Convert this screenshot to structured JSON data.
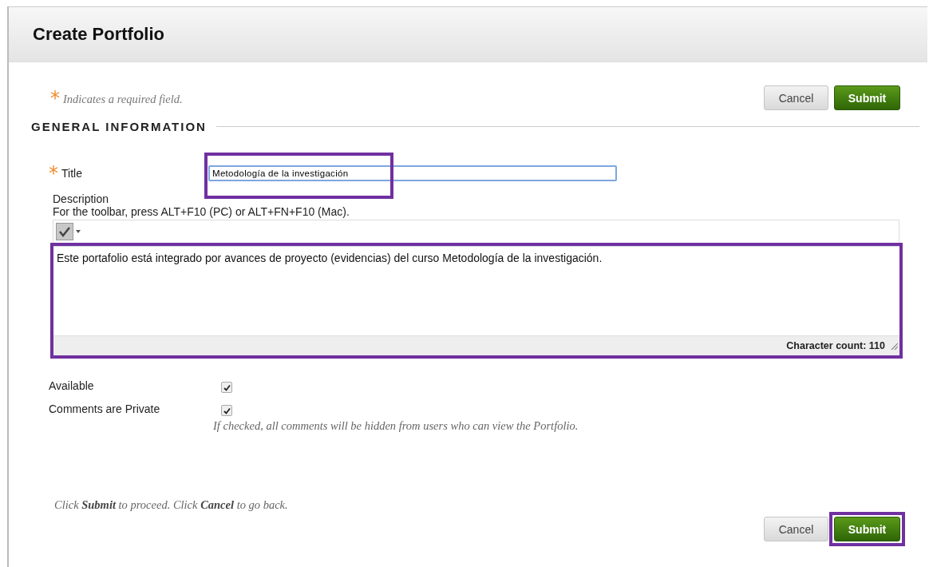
{
  "page": {
    "title": "Create Portfolio"
  },
  "required_note": "Indicates a required field.",
  "required_mark": "*",
  "top_buttons": [
    {
      "kind": "cancel",
      "label": "Cancel"
    },
    {
      "kind": "submit",
      "label": "Submit"
    }
  ],
  "section": {
    "heading": "GENERAL INFORMATION"
  },
  "title_field": {
    "label": "Title",
    "required": true,
    "value": "Metodología de la investigación",
    "highlighted": true
  },
  "description": {
    "label": "Description",
    "hint": "For the toolbar, press ALT+F10 (PC) or ALT+FN+F10 (Mac).",
    "text": "Este portafolio está integrado por avances de proyecto (evidencias) del curso Metodología de la investigación.",
    "character_count": "Character count: 110",
    "highlighted": true
  },
  "options": [
    {
      "label": "Available",
      "checked": true
    },
    {
      "label": "Comments are Private",
      "checked": true,
      "hint": "If checked, all comments will be hidden from users who can view the Portfolio."
    }
  ],
  "footer_note": "Click **Submit** to proceed. Click **Cancel** to go back.",
  "bottom_buttons": [
    {
      "kind": "cancel",
      "label": "Cancel"
    },
    {
      "kind": "submit",
      "label": "Submit",
      "highlighted": true
    }
  ]
}
